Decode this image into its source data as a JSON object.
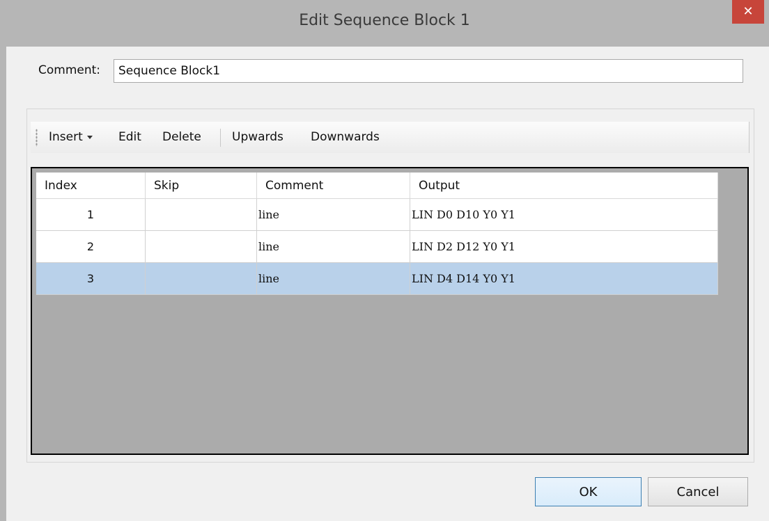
{
  "window": {
    "title": "Edit Sequence Block 1",
    "close_glyph": "✕"
  },
  "comment": {
    "label": "Comment:",
    "value": "Sequence Block1"
  },
  "toolbar": {
    "insert_label": "Insert",
    "edit_label": "Edit",
    "delete_label": "Delete",
    "upwards_label": "Upwards",
    "downwards_label": "Downwards"
  },
  "table": {
    "columns": [
      "Index",
      "Skip",
      "Comment",
      "Output"
    ],
    "rows": [
      {
        "index": "1",
        "skip": "",
        "comment": "line",
        "output": "LIN D0 D10 Y0 Y1",
        "selected": false
      },
      {
        "index": "2",
        "skip": "",
        "comment": "line",
        "output": "LIN D2 D12 Y0 Y1",
        "selected": false
      },
      {
        "index": "3",
        "skip": "",
        "comment": "line",
        "output": "LIN D4 D14 Y0 Y1",
        "selected": true
      }
    ]
  },
  "buttons": {
    "ok_label": "OK",
    "cancel_label": "Cancel"
  },
  "colors": {
    "selection": "#b9d1ea",
    "close": "#c7453a",
    "grid_background": "#ababab"
  }
}
